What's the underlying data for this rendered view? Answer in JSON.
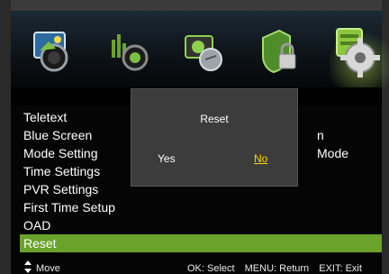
{
  "colors": {
    "selected": "#6aa22c",
    "dialog_bg": "#3c3c3c",
    "highlight_text": "#ffd500"
  },
  "icons": [
    {
      "name": "picture-icon"
    },
    {
      "name": "sound-icon"
    },
    {
      "name": "channel-icon"
    },
    {
      "name": "lock-icon"
    },
    {
      "name": "setup-gear-icon",
      "active": true
    }
  ],
  "menu": {
    "items": [
      {
        "label": "Teletext"
      },
      {
        "label": "Blue Screen"
      },
      {
        "label": "Mode Setting"
      },
      {
        "label": "Time Settings"
      },
      {
        "label": "PVR Settings"
      },
      {
        "label": "First Time Setup"
      },
      {
        "label": "OAD"
      },
      {
        "label": "Reset",
        "selected": true
      }
    ],
    "partial_values": [
      "n",
      "Mode"
    ]
  },
  "dialog": {
    "title": "Reset",
    "yes": "Yes",
    "no": "No",
    "focused": "No"
  },
  "footer": {
    "move": "Move",
    "ok": "OK: Select",
    "menu": "MENU: Return",
    "exit": "EXIT: Exit"
  }
}
